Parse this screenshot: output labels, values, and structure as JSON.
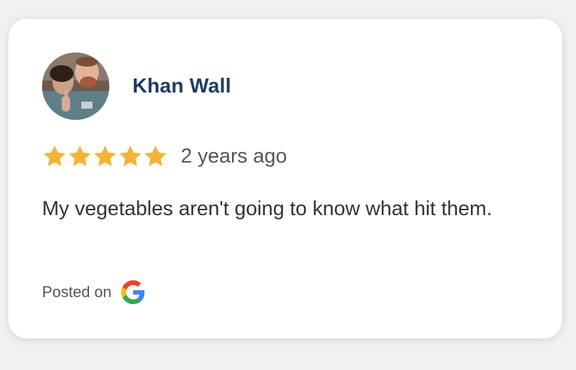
{
  "review": {
    "reviewer_name": "Khan Wall",
    "avatar_icon": "reviewer-avatar-photo",
    "rating": 5,
    "rating_max": 5,
    "star_color": "#f4b43a",
    "time_ago": "2 years ago",
    "text": "My vegetables aren't going to know what hit them.",
    "posted_on_label": "Posted on",
    "source_icon": "google-icon"
  },
  "colors": {
    "name": "#1f3b67",
    "text": "#333333",
    "muted": "#555555",
    "background": "#f0f0f0",
    "card": "#ffffff"
  }
}
